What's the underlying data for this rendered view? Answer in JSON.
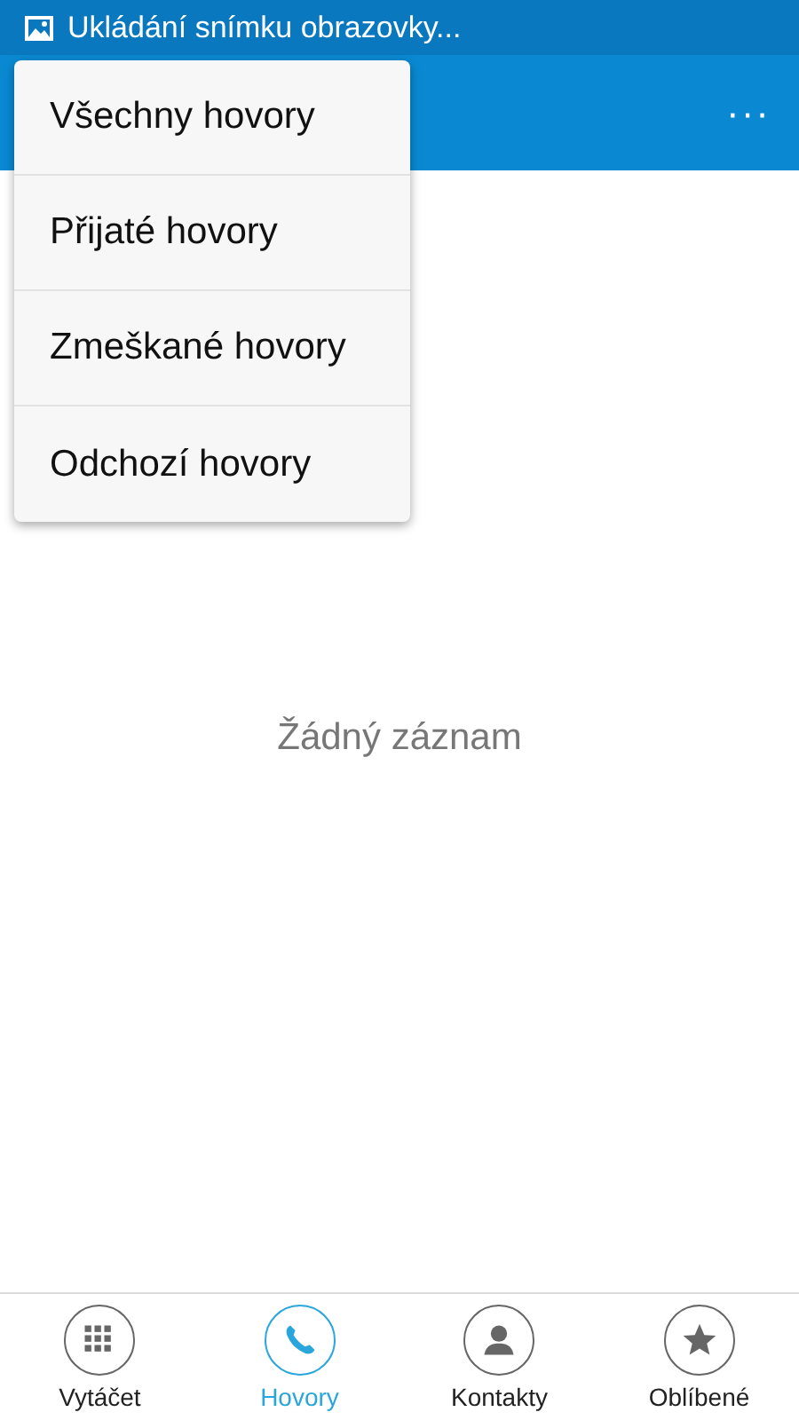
{
  "status_bar": {
    "notification": "Ukládání snímku obrazovky..."
  },
  "app_bar": {
    "overflow": "···"
  },
  "menu": [
    {
      "label": "Všechny hovory"
    },
    {
      "label": "Přijaté hovory"
    },
    {
      "label": "Zmeškané hovory"
    },
    {
      "label": "Odchozí hovory"
    }
  ],
  "empty_message": "Žádný záznam",
  "bottom_tabs": [
    {
      "kind": "dialpad",
      "label": "Vytáčet",
      "selected": false
    },
    {
      "kind": "phone",
      "label": "Hovory",
      "selected": true
    },
    {
      "kind": "person",
      "label": "Kontakty",
      "selected": false
    },
    {
      "kind": "star",
      "label": "Oblíbené",
      "selected": false
    }
  ]
}
